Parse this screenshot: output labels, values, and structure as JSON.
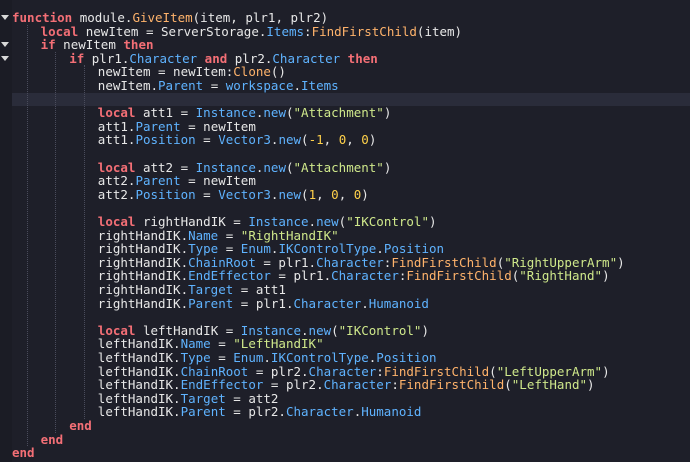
{
  "colors": {
    "background": "#1e1f29",
    "current_line": "#2a2c3a",
    "text": "#e8e8e8",
    "keyword": "#f46f76",
    "function": "#ffb36b",
    "property": "#5fb3ff",
    "string": "#cfe88b",
    "number": "#ffd14a"
  },
  "icons": {
    "fold": "fold-arrow-icon"
  },
  "editor": {
    "current_line_index": 6,
    "folds": [
      0,
      2,
      3
    ],
    "lines": [
      {
        "indent": 0,
        "tokens": [
          [
            "kw",
            "function"
          ],
          [
            "id",
            " module."
          ],
          [
            "fn",
            "GiveItem"
          ],
          [
            "id",
            "(item, plr1, plr2)"
          ]
        ]
      },
      {
        "indent": 1,
        "tokens": [
          [
            "kw",
            "local"
          ],
          [
            "id",
            " newItem = ServerStorage."
          ],
          [
            "prop",
            "Items"
          ],
          [
            "id",
            ":"
          ],
          [
            "fn",
            "FindFirstChild"
          ],
          [
            "id",
            "(item)"
          ]
        ]
      },
      {
        "indent": 1,
        "tokens": [
          [
            "kw",
            "if"
          ],
          [
            "id",
            " newItem "
          ],
          [
            "kw",
            "then"
          ]
        ]
      },
      {
        "indent": 2,
        "tokens": [
          [
            "kw",
            "if"
          ],
          [
            "id",
            " plr1."
          ],
          [
            "prop",
            "Character"
          ],
          [
            "id",
            " "
          ],
          [
            "kw",
            "and"
          ],
          [
            "id",
            " plr2."
          ],
          [
            "prop",
            "Character"
          ],
          [
            "id",
            " "
          ],
          [
            "kw",
            "then"
          ]
        ]
      },
      {
        "indent": 3,
        "tokens": [
          [
            "id",
            "newItem = newItem:"
          ],
          [
            "fn",
            "Clone"
          ],
          [
            "id",
            "()"
          ]
        ]
      },
      {
        "indent": 3,
        "tokens": [
          [
            "id",
            "newItem."
          ],
          [
            "prop",
            "Parent"
          ],
          [
            "id",
            " = "
          ],
          [
            "prop",
            "workspace"
          ],
          [
            "id",
            "."
          ],
          [
            "prop",
            "Items"
          ]
        ]
      },
      {
        "indent": 0,
        "tokens": []
      },
      {
        "indent": 3,
        "tokens": [
          [
            "kw",
            "local"
          ],
          [
            "id",
            " att1 = "
          ],
          [
            "prop",
            "Instance"
          ],
          [
            "id",
            "."
          ],
          [
            "prop",
            "new"
          ],
          [
            "id",
            "("
          ],
          [
            "str",
            "\"Attachment\""
          ],
          [
            "id",
            ")"
          ]
        ]
      },
      {
        "indent": 3,
        "tokens": [
          [
            "id",
            "att1."
          ],
          [
            "prop",
            "Parent"
          ],
          [
            "id",
            " = newItem"
          ]
        ]
      },
      {
        "indent": 3,
        "tokens": [
          [
            "id",
            "att1."
          ],
          [
            "prop",
            "Position"
          ],
          [
            "id",
            " = "
          ],
          [
            "prop",
            "Vector3"
          ],
          [
            "id",
            "."
          ],
          [
            "prop",
            "new"
          ],
          [
            "id",
            "("
          ],
          [
            "num",
            "-1"
          ],
          [
            "id",
            ", "
          ],
          [
            "num",
            "0"
          ],
          [
            "id",
            ", "
          ],
          [
            "num",
            "0"
          ],
          [
            "id",
            ")"
          ]
        ]
      },
      {
        "indent": 0,
        "tokens": []
      },
      {
        "indent": 3,
        "tokens": [
          [
            "kw",
            "local"
          ],
          [
            "id",
            " att2 = "
          ],
          [
            "prop",
            "Instance"
          ],
          [
            "id",
            "."
          ],
          [
            "prop",
            "new"
          ],
          [
            "id",
            "("
          ],
          [
            "str",
            "\"Attachment\""
          ],
          [
            "id",
            ")"
          ]
        ]
      },
      {
        "indent": 3,
        "tokens": [
          [
            "id",
            "att2."
          ],
          [
            "prop",
            "Parent"
          ],
          [
            "id",
            " = newItem"
          ]
        ]
      },
      {
        "indent": 3,
        "tokens": [
          [
            "id",
            "att2."
          ],
          [
            "prop",
            "Position"
          ],
          [
            "id",
            " = "
          ],
          [
            "prop",
            "Vector3"
          ],
          [
            "id",
            "."
          ],
          [
            "prop",
            "new"
          ],
          [
            "id",
            "("
          ],
          [
            "num",
            "1"
          ],
          [
            "id",
            ", "
          ],
          [
            "num",
            "0"
          ],
          [
            "id",
            ", "
          ],
          [
            "num",
            "0"
          ],
          [
            "id",
            ")"
          ]
        ]
      },
      {
        "indent": 0,
        "tokens": []
      },
      {
        "indent": 3,
        "tokens": [
          [
            "kw",
            "local"
          ],
          [
            "id",
            " rightHandIK = "
          ],
          [
            "prop",
            "Instance"
          ],
          [
            "id",
            "."
          ],
          [
            "prop",
            "new"
          ],
          [
            "id",
            "("
          ],
          [
            "str",
            "\"IKControl\""
          ],
          [
            "id",
            ")"
          ]
        ]
      },
      {
        "indent": 3,
        "tokens": [
          [
            "id",
            "rightHandIK."
          ],
          [
            "prop",
            "Name"
          ],
          [
            "id",
            " = "
          ],
          [
            "str",
            "\"RightHandIK\""
          ]
        ]
      },
      {
        "indent": 3,
        "tokens": [
          [
            "id",
            "rightHandIK."
          ],
          [
            "prop",
            "Type"
          ],
          [
            "id",
            " = "
          ],
          [
            "prop",
            "Enum"
          ],
          [
            "id",
            "."
          ],
          [
            "prop",
            "IKControlType"
          ],
          [
            "id",
            "."
          ],
          [
            "prop",
            "Position"
          ]
        ]
      },
      {
        "indent": 3,
        "tokens": [
          [
            "id",
            "rightHandIK."
          ],
          [
            "prop",
            "ChainRoot"
          ],
          [
            "id",
            " = plr1."
          ],
          [
            "prop",
            "Character"
          ],
          [
            "id",
            ":"
          ],
          [
            "fn",
            "FindFirstChild"
          ],
          [
            "id",
            "("
          ],
          [
            "str",
            "\"RightUpperArm\""
          ],
          [
            "id",
            ")"
          ]
        ]
      },
      {
        "indent": 3,
        "tokens": [
          [
            "id",
            "rightHandIK."
          ],
          [
            "prop",
            "EndEffector"
          ],
          [
            "id",
            " = plr1."
          ],
          [
            "prop",
            "Character"
          ],
          [
            "id",
            ":"
          ],
          [
            "fn",
            "FindFirstChild"
          ],
          [
            "id",
            "("
          ],
          [
            "str",
            "\"RightHand\""
          ],
          [
            "id",
            ")"
          ]
        ]
      },
      {
        "indent": 3,
        "tokens": [
          [
            "id",
            "rightHandIK."
          ],
          [
            "prop",
            "Target"
          ],
          [
            "id",
            " = att1"
          ]
        ]
      },
      {
        "indent": 3,
        "tokens": [
          [
            "id",
            "rightHandIK."
          ],
          [
            "prop",
            "Parent"
          ],
          [
            "id",
            " = plr1."
          ],
          [
            "prop",
            "Character"
          ],
          [
            "id",
            "."
          ],
          [
            "prop",
            "Humanoid"
          ]
        ]
      },
      {
        "indent": 0,
        "tokens": []
      },
      {
        "indent": 3,
        "tokens": [
          [
            "kw",
            "local"
          ],
          [
            "id",
            " leftHandIK = "
          ],
          [
            "prop",
            "Instance"
          ],
          [
            "id",
            "."
          ],
          [
            "prop",
            "new"
          ],
          [
            "id",
            "("
          ],
          [
            "str",
            "\"IKControl\""
          ],
          [
            "id",
            ")"
          ]
        ]
      },
      {
        "indent": 3,
        "tokens": [
          [
            "id",
            "leftHandIK."
          ],
          [
            "prop",
            "Name"
          ],
          [
            "id",
            " = "
          ],
          [
            "str",
            "\"LeftHandIK\""
          ]
        ]
      },
      {
        "indent": 3,
        "tokens": [
          [
            "id",
            "leftHandIK."
          ],
          [
            "prop",
            "Type"
          ],
          [
            "id",
            " = "
          ],
          [
            "prop",
            "Enum"
          ],
          [
            "id",
            "."
          ],
          [
            "prop",
            "IKControlType"
          ],
          [
            "id",
            "."
          ],
          [
            "prop",
            "Position"
          ]
        ]
      },
      {
        "indent": 3,
        "tokens": [
          [
            "id",
            "leftHandIK."
          ],
          [
            "prop",
            "ChainRoot"
          ],
          [
            "id",
            " = plr2."
          ],
          [
            "prop",
            "Character"
          ],
          [
            "id",
            ":"
          ],
          [
            "fn",
            "FindFirstChild"
          ],
          [
            "id",
            "("
          ],
          [
            "str",
            "\"LeftUpperArm\""
          ],
          [
            "id",
            ")"
          ]
        ]
      },
      {
        "indent": 3,
        "tokens": [
          [
            "id",
            "leftHandIK."
          ],
          [
            "prop",
            "EndEffector"
          ],
          [
            "id",
            " = plr2."
          ],
          [
            "prop",
            "Character"
          ],
          [
            "id",
            ":"
          ],
          [
            "fn",
            "FindFirstChild"
          ],
          [
            "id",
            "("
          ],
          [
            "str",
            "\"LeftHand\""
          ],
          [
            "id",
            ")"
          ]
        ]
      },
      {
        "indent": 3,
        "tokens": [
          [
            "id",
            "leftHandIK."
          ],
          [
            "prop",
            "Target"
          ],
          [
            "id",
            " = att2"
          ]
        ]
      },
      {
        "indent": 3,
        "tokens": [
          [
            "id",
            "leftHandIK."
          ],
          [
            "prop",
            "Parent"
          ],
          [
            "id",
            " = plr2."
          ],
          [
            "prop",
            "Character"
          ],
          [
            "id",
            "."
          ],
          [
            "prop",
            "Humanoid"
          ]
        ]
      },
      {
        "indent": 2,
        "tokens": [
          [
            "kw",
            "end"
          ]
        ]
      },
      {
        "indent": 1,
        "tokens": [
          [
            "kw",
            "end"
          ]
        ]
      },
      {
        "indent": 0,
        "tokens": [
          [
            "kw",
            "end"
          ]
        ]
      }
    ]
  }
}
